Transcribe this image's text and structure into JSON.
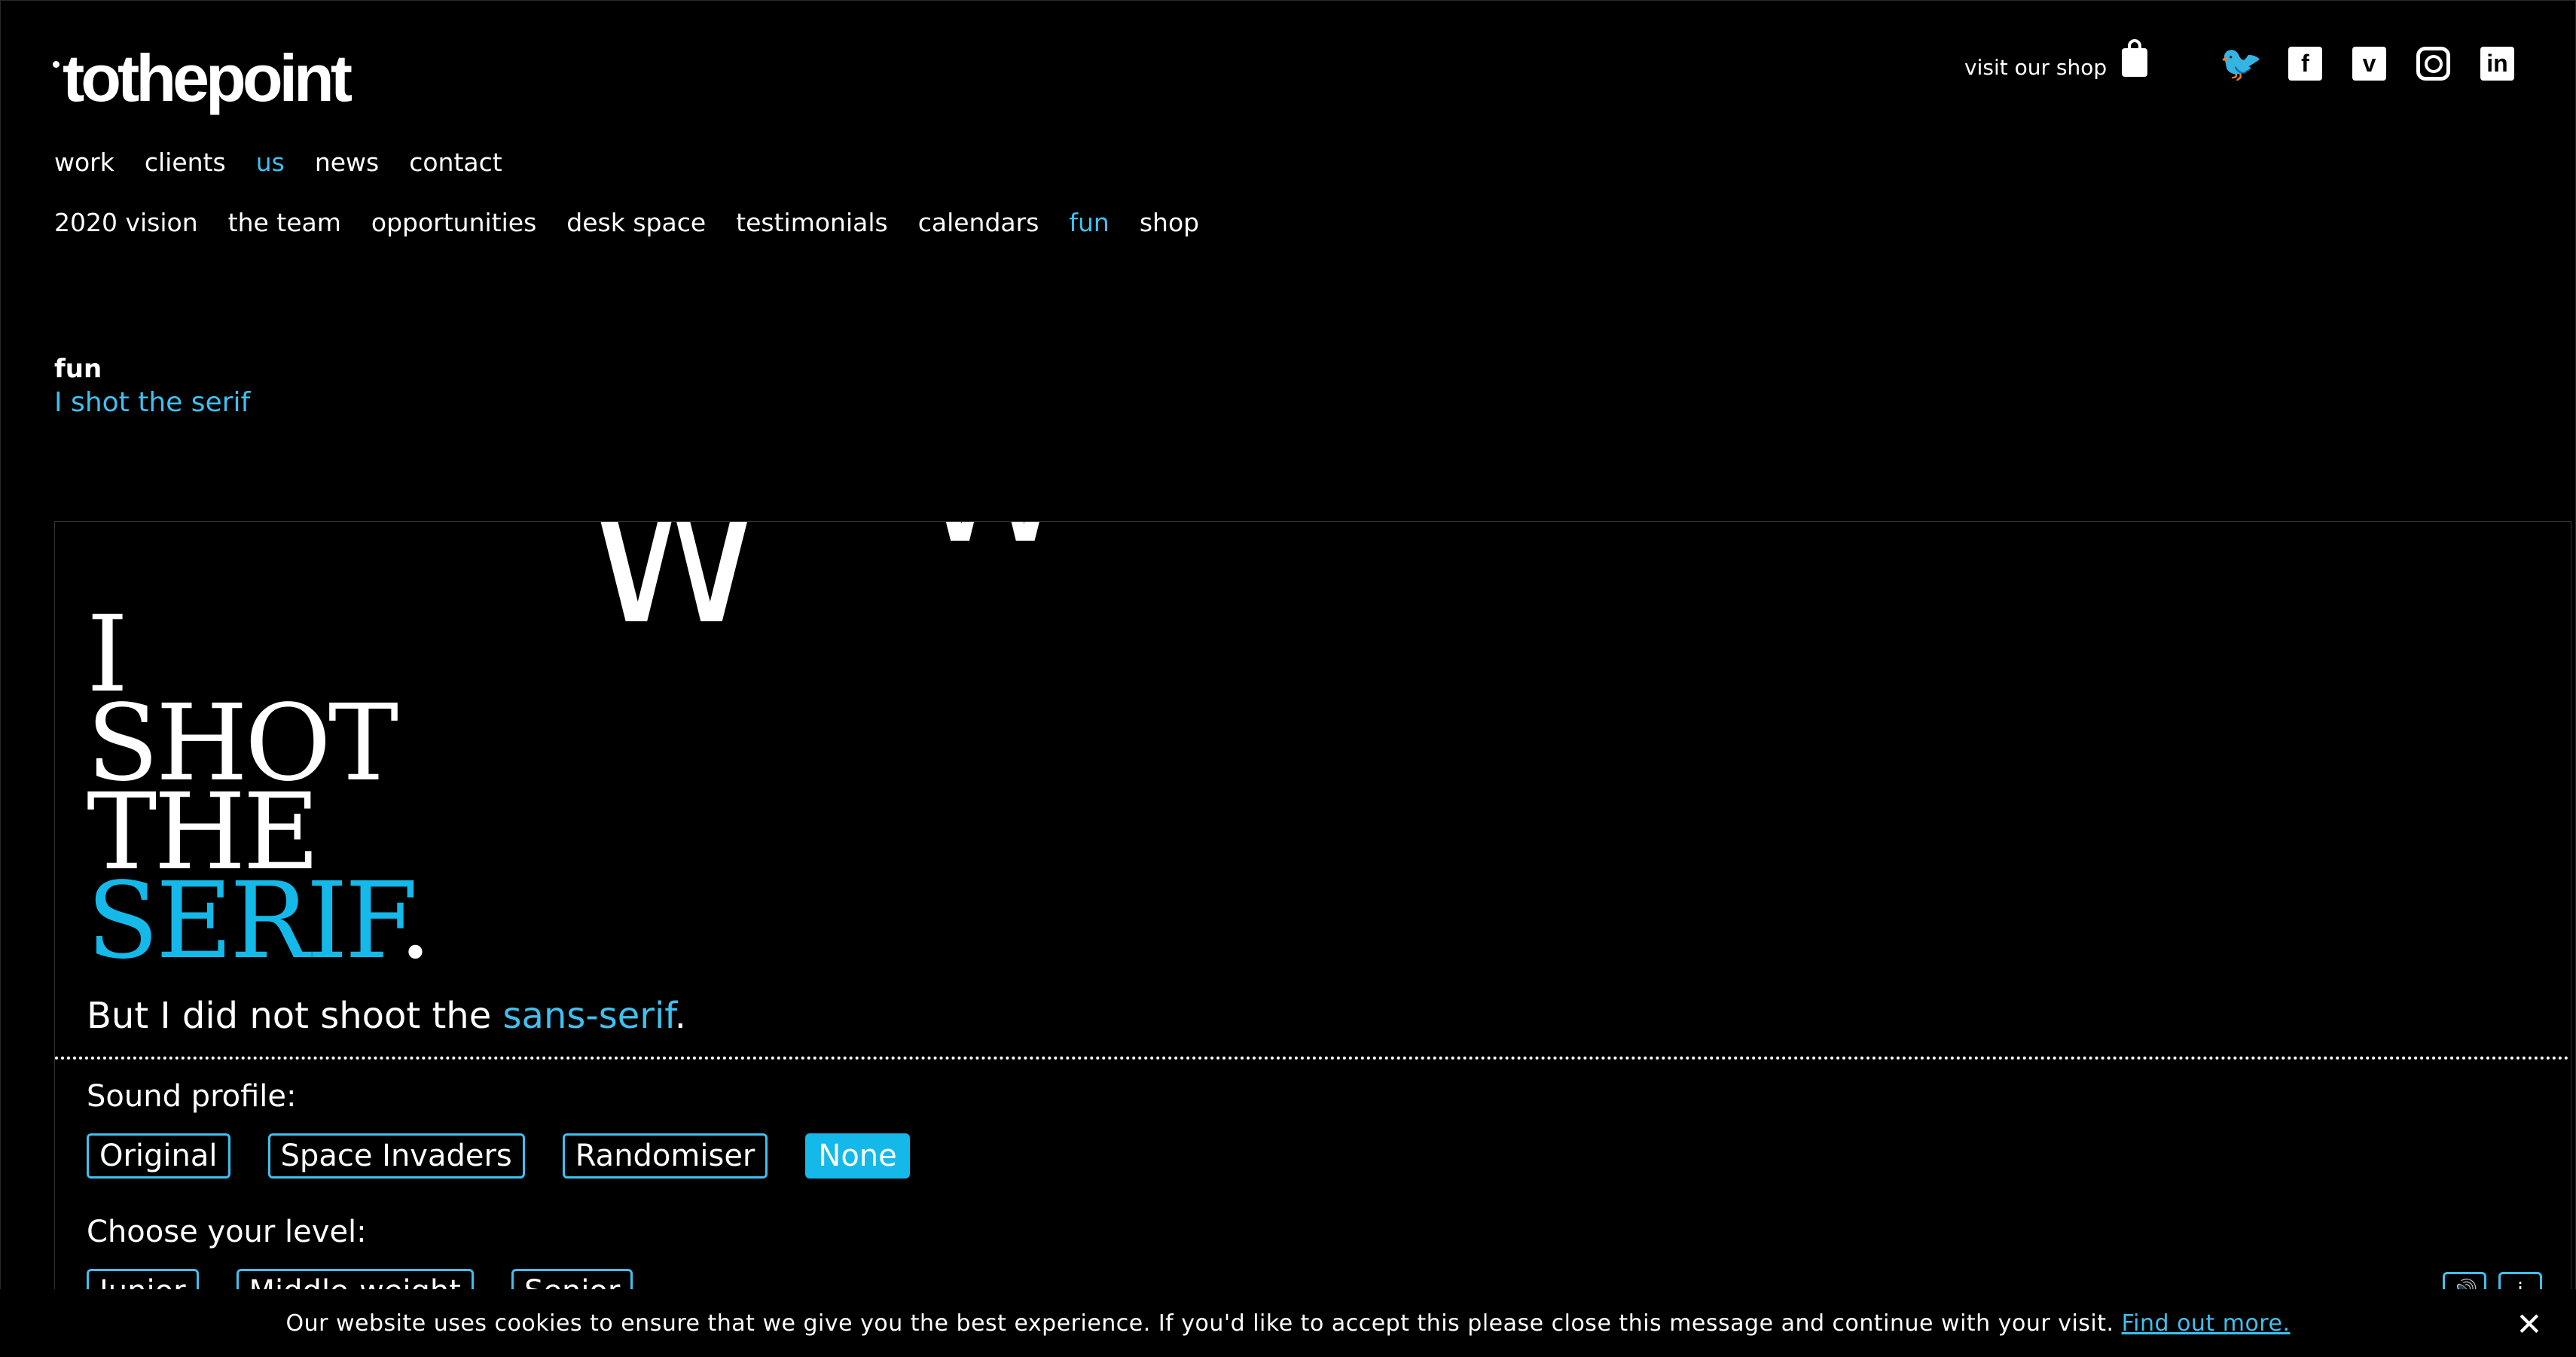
{
  "header": {
    "logo": "tothepoint",
    "shop_link": "visit our shop",
    "social": [
      "twitter-icon",
      "facebook-icon",
      "vimeo-icon",
      "instagram-icon",
      "linkedin-icon"
    ],
    "social_glyphs": {
      "twitter": "🐦",
      "facebook": "f",
      "vimeo": "v",
      "linkedin": "in"
    }
  },
  "nav": {
    "primary": [
      "work",
      "clients",
      "us",
      "news",
      "contact"
    ],
    "primary_active": "us",
    "secondary": [
      "2020 vision",
      "the team",
      "opportunities",
      "desk space",
      "testimonials",
      "calendars",
      "fun",
      "shop"
    ],
    "secondary_active": "fun"
  },
  "page": {
    "section": "fun",
    "subtitle": "I shot the serif"
  },
  "game": {
    "falling_letters": [
      "W",
      "W"
    ],
    "title_lines": [
      "I",
      "SHOT",
      "THE"
    ],
    "title_accent": "SERIF",
    "title_end": ".",
    "tagline_start": "But I did not shoot the ",
    "tagline_accent": "sans-serif",
    "tagline_end": ".",
    "sound_label": "Sound profile:",
    "sound_options": [
      "Original",
      "Space Invaders",
      "Randomiser",
      "None"
    ],
    "sound_selected": "None",
    "level_label": "Choose your level:",
    "level_options": [
      "Junior",
      "Middle-weight",
      "Senior"
    ]
  },
  "cookie": {
    "message": "Our website uses cookies to ensure that we give you the best experience. If you'd like to accept this please close this message and continue with your visit.",
    "link": "Find out more.",
    "close": "✕"
  },
  "colors": {
    "accent": "#3fc0f0",
    "accent_strong": "#14b9ea",
    "background": "#000000"
  }
}
